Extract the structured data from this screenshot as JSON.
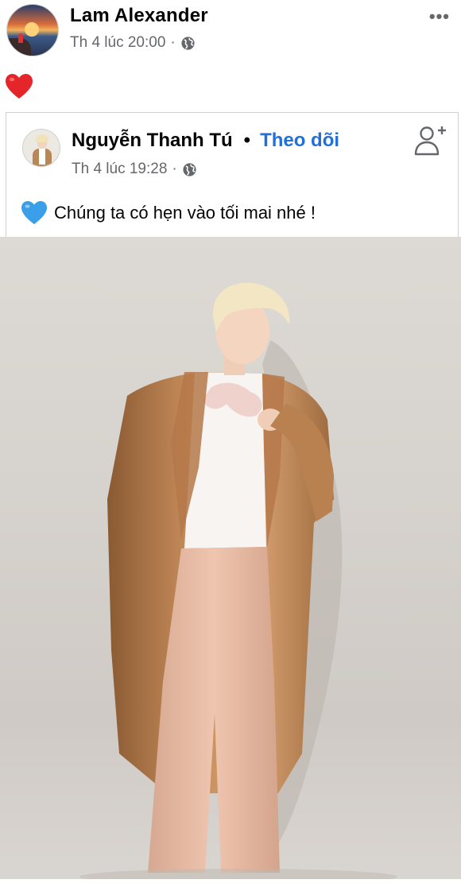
{
  "post": {
    "author": "Lam Alexander",
    "timestamp": "Th 4 lúc 20:00",
    "separator": "·",
    "privacy_icon": "globe-icon",
    "more_icon": "more-horizontal-icon",
    "reaction_icon": "red-heart-icon"
  },
  "shared_post": {
    "author": "Nguyễn Thanh Tú",
    "separator": "•",
    "follow_label": "Theo dõi",
    "timestamp": "Th 4 lúc 19:28",
    "meta_separator": "·",
    "privacy_icon": "globe-icon",
    "add_friend_icon": "add-friend-icon",
    "text": "Chúng ta có hẹn vào tối mai nhé !",
    "text_icon": "blue-heart-icon"
  },
  "colors": {
    "link_blue": "#216fdb",
    "meta_gray": "#65676b",
    "heart_red": "#e4262b",
    "heart_blue": "#3a9ee8"
  }
}
